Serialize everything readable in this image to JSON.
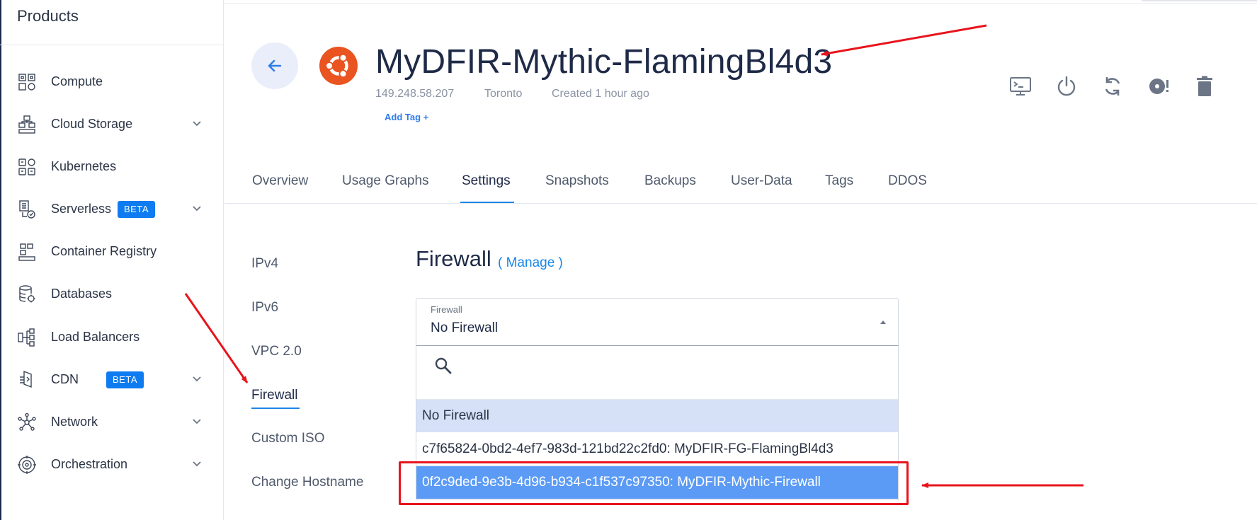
{
  "sidebar": {
    "title": "Products",
    "items": [
      {
        "label": "Compute",
        "icon": "compute-icon",
        "expandable": false
      },
      {
        "label": "Cloud Storage",
        "icon": "cloud-storage-icon",
        "expandable": true
      },
      {
        "label": "Kubernetes",
        "icon": "kubernetes-icon",
        "expandable": false
      },
      {
        "label": "Serverless",
        "icon": "serverless-icon",
        "expandable": true,
        "badge": "BETA"
      },
      {
        "label": "Container Registry",
        "icon": "container-registry-icon",
        "expandable": false
      },
      {
        "label": "Databases",
        "icon": "databases-icon",
        "expandable": false
      },
      {
        "label": "Load Balancers",
        "icon": "load-balancers-icon",
        "expandable": false
      },
      {
        "label": "CDN",
        "icon": "cdn-icon",
        "expandable": true,
        "badge": "BETA"
      },
      {
        "label": "Network",
        "icon": "network-icon",
        "expandable": true
      },
      {
        "label": "Orchestration",
        "icon": "orchestration-icon",
        "expandable": true
      }
    ]
  },
  "instance": {
    "title": "MyDFIR-Mythic-FlamingBl4d3",
    "ip": "149.248.58.207",
    "location": "Toronto",
    "created": "Created 1 hour ago",
    "add_tag": "Add Tag +",
    "os_icon": "ubuntu-logo-icon",
    "brand_color": "#e95420"
  },
  "actions": [
    {
      "name": "console-button",
      "icon": "console-icon"
    },
    {
      "name": "power-button",
      "icon": "power-icon"
    },
    {
      "name": "restart-button",
      "icon": "restart-icon"
    },
    {
      "name": "reinstall-button",
      "icon": "reinstall-icon"
    },
    {
      "name": "delete-button",
      "icon": "trash-icon"
    }
  ],
  "tabs": [
    {
      "label": "Overview"
    },
    {
      "label": "Usage Graphs"
    },
    {
      "label": "Settings",
      "active": true
    },
    {
      "label": "Snapshots"
    },
    {
      "label": "Backups"
    },
    {
      "label": "User-Data"
    },
    {
      "label": "Tags"
    },
    {
      "label": "DDOS"
    }
  ],
  "settings_nav": [
    {
      "label": "IPv4"
    },
    {
      "label": "IPv6"
    },
    {
      "label": "VPC 2.0"
    },
    {
      "label": "Firewall",
      "active": true
    },
    {
      "label": "Custom ISO"
    },
    {
      "label": "Change Hostname"
    }
  ],
  "firewall": {
    "heading": "Firewall",
    "manage": "( Manage )",
    "select_label": "Firewall",
    "selected_value": "No Firewall",
    "search_placeholder": "",
    "options": [
      {
        "label": "No Firewall",
        "state": "selected"
      },
      {
        "label": "c7f65824-0bd2-4ef7-983d-121bd22c2fd0: MyDFIR-FG-FlamingBl4d3",
        "state": "normal"
      },
      {
        "label": "0f2c9ded-9e3b-4d96-b934-c1f537c97350: MyDFIR-Mythic-Firewall",
        "state": "hovered"
      }
    ]
  },
  "colors": {
    "accent": "#1a86e8",
    "badge": "#0e7cf0",
    "annotation_red": "#e8141c",
    "option_selected_bg": "#d6e0f7",
    "option_hover_bg": "#5b9bf5"
  }
}
